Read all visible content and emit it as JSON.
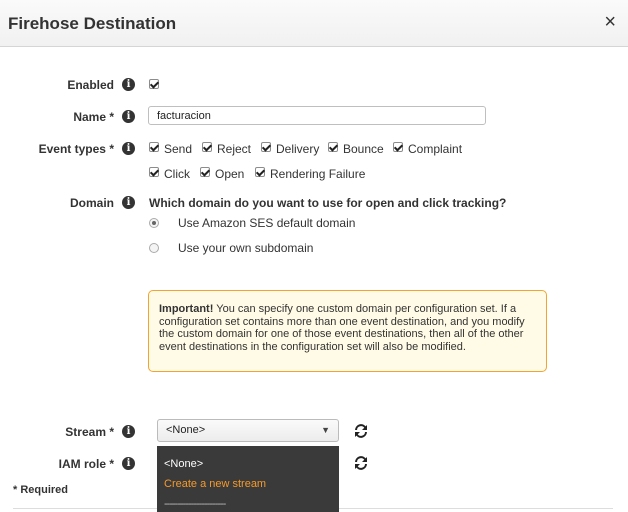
{
  "dialog": {
    "title": "Firehose Destination",
    "close_glyph": "×"
  },
  "fields": {
    "enabled_label": "Enabled",
    "name_label": "Name *",
    "name_value": "facturacion",
    "event_types_label": "Event types *",
    "domain_label": "Domain",
    "stream_label": "Stream *",
    "iam_role_label": "IAM role *",
    "info_glyph": "i"
  },
  "enabled_checked": true,
  "event_types": [
    {
      "label": "Send",
      "checked": true
    },
    {
      "label": "Reject",
      "checked": true
    },
    {
      "label": "Delivery",
      "checked": true
    },
    {
      "label": "Bounce",
      "checked": true
    },
    {
      "label": "Complaint",
      "checked": true
    },
    {
      "label": "Click",
      "checked": true
    },
    {
      "label": "Open",
      "checked": true
    },
    {
      "label": "Rendering Failure",
      "checked": true
    }
  ],
  "domain": {
    "question": "Which domain do you want to use for open and click tracking?",
    "options": [
      {
        "label": "Use Amazon SES default domain",
        "selected": true
      },
      {
        "label": "Use your own subdomain",
        "selected": false
      }
    ]
  },
  "alert": {
    "strong": "Important!",
    "text": "You can specify one custom domain per configuration set. If a configuration set contains more than one event destination, and you modify the custom domain for one of those event destinations, then all of the other event destinations in the configuration set will also be modified."
  },
  "stream": {
    "selected": "<None>",
    "dropdown_items": [
      "<None>",
      "Create a new stream",
      "-----------------------"
    ]
  },
  "required_note": "* Required",
  "colors": {
    "accent": "#f59a2a",
    "alert_border": "#f0a530",
    "alert_bg": "#fffbe6",
    "dropdown_bg": "#3a3a3a"
  },
  "icons": {
    "close": "close-icon",
    "info": "info-icon",
    "refresh": "refresh-icon",
    "select_chevron": "chevron-down-icon"
  }
}
